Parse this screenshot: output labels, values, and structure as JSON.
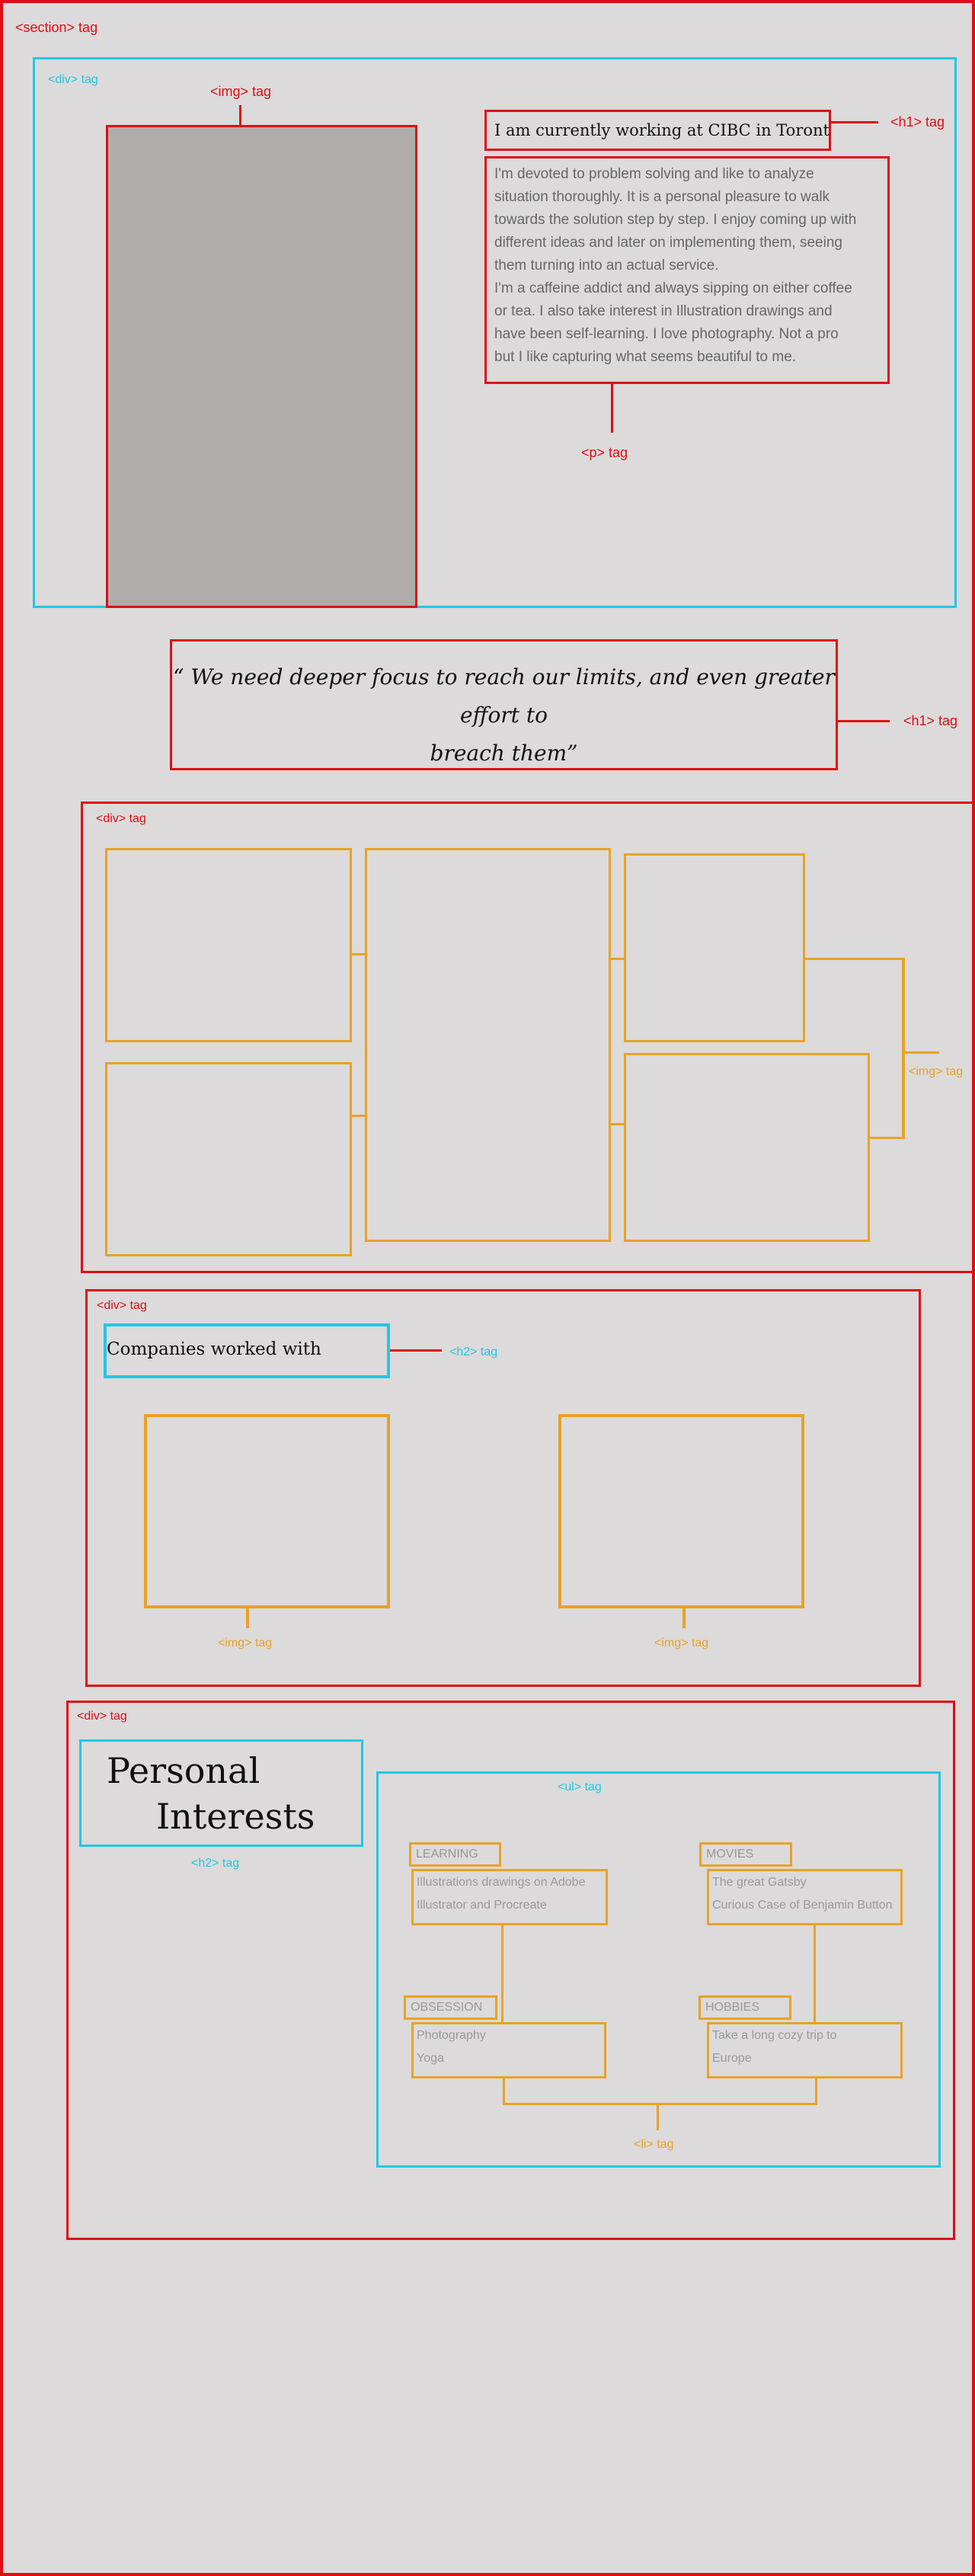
{
  "labels": {
    "section": "<section> tag",
    "div": "<div> tag",
    "img": "<img> tag",
    "h1": "<h1> tag",
    "h2": "<h2> tag",
    "p": "<p> tag",
    "ul": "<ul> tag",
    "li": "<li> tag"
  },
  "about": {
    "heading": "I am currently working at CIBC in Toronto.",
    "paragraph_lines": [
      "I'm devoted to problem solving and like to analyze",
      "situation thoroughly. It is a personal pleasure to walk",
      "towards the solution step by step. I enjoy coming up with",
      "different ideas and later on implementing them, seeing",
      "them turning into an actual service.",
      "I'm a caffeine addict and always sipping on either coffee",
      "or tea. I also take interest in Illustration drawings and",
      "have been self-learning. I love photography. Not a pro",
      "but I like capturing what seems beautiful to me."
    ]
  },
  "quote": {
    "line1": "“ We need deeper focus to reach our limits, and even greater effort to",
    "line2": "breach them”"
  },
  "companies": {
    "heading": "Companies worked with"
  },
  "interests": {
    "heading_line1": "Personal",
    "heading_line2": "Interests",
    "items": [
      {
        "tag": "LEARNING",
        "lines": [
          "Illustrations drawings on Adobe",
          "Illustrator and Procreate"
        ]
      },
      {
        "tag": "MOVIES",
        "lines": [
          "The great Gatsby",
          "Curious Case of Benjamin Button"
        ]
      },
      {
        "tag": "OBSESSION",
        "lines": [
          "Photography",
          "Yoga"
        ]
      },
      {
        "tag": "HOBBIES",
        "lines": [
          "Take a long cozy trip to",
          "Europe"
        ]
      }
    ]
  },
  "colors": {
    "background": "#dcdada",
    "section_outline": "#e00c16",
    "div_outline": "#22c7e6",
    "img_outline": "#e8a226",
    "image_placeholder": "#b0acab"
  }
}
